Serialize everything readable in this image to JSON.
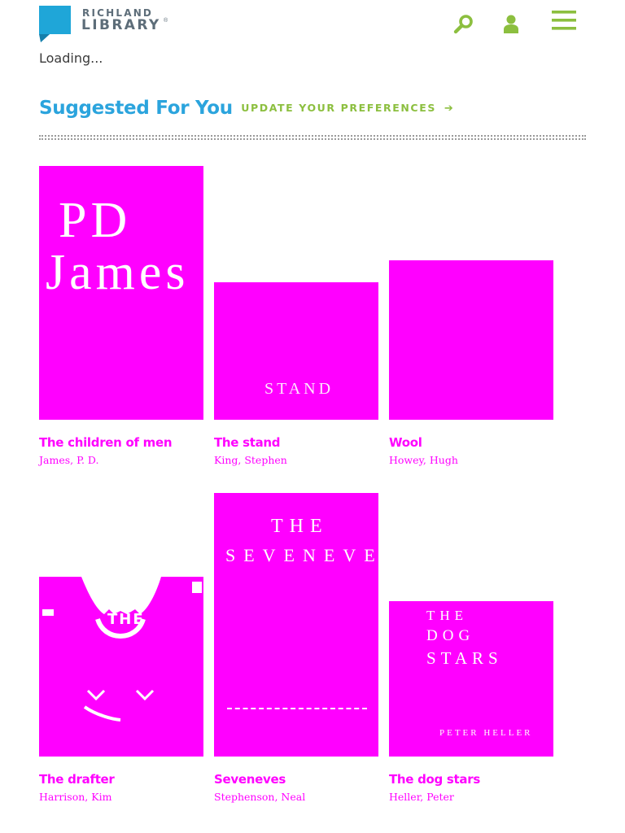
{
  "header": {
    "logo_line1": "RICHLAND",
    "logo_line2": "LIBRARY",
    "logo_reg": "®",
    "icons": [
      "search-icon",
      "account-icon",
      "menu-icon"
    ],
    "colors": {
      "logo_blue": "#1fa6d8",
      "icon_green": "#8cbf3f",
      "logo_text": "#5d6d79"
    }
  },
  "status": {
    "loading": "Loading..."
  },
  "suggested": {
    "title": "Suggested For You",
    "prefs_link": "UPDATE YOUR PREFERENCES",
    "title_color": "#2ba4dd",
    "link_color": "#8cbf3f"
  },
  "books": [
    {
      "title": "The children of men",
      "author": "James, P. D.",
      "cover_text": [
        "PD",
        "James"
      ]
    },
    {
      "title": "The stand",
      "author": "King, Stephen",
      "cover_text": [
        "STAND"
      ]
    },
    {
      "title": "Wool",
      "author": "Howey, Hugh",
      "cover_text": []
    },
    {
      "title": "The drafter",
      "author": "Harrison, Kim",
      "cover_text": [
        "THE"
      ]
    },
    {
      "title": "Seveneves",
      "author": "Stephenson, Neal",
      "cover_text": [
        "THE",
        "SEVENEVES"
      ]
    },
    {
      "title": "The dog stars",
      "author": "Heller, Peter",
      "cover_text": [
        "THE",
        "DOG",
        "STARS",
        "PETER HELLER"
      ]
    }
  ],
  "placeholder_color": "#ff00ff"
}
